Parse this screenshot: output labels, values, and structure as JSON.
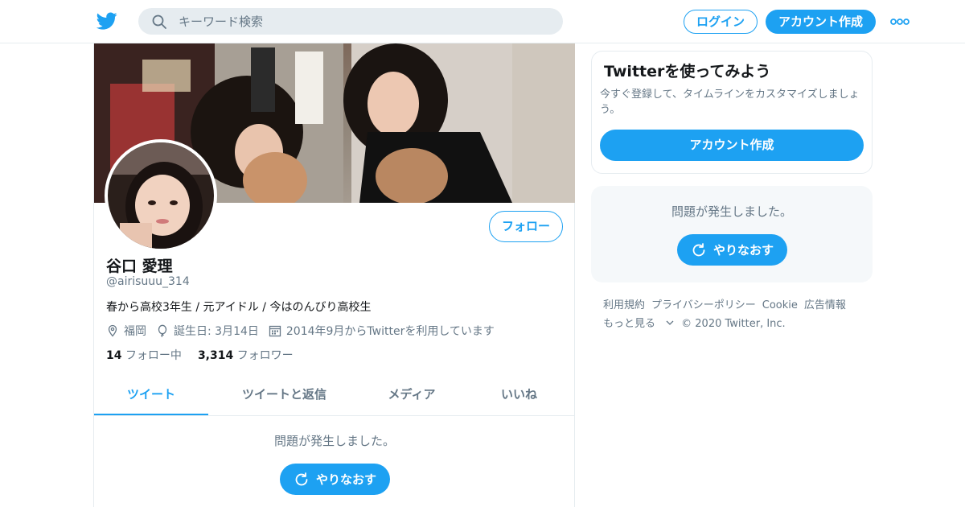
{
  "header": {
    "search_placeholder": "キーワード検索",
    "login_label": "ログイン",
    "signup_label": "アカウント作成"
  },
  "profile": {
    "name": "谷口 愛理",
    "handle": "@airisuuu_314",
    "bio": "春から高校3年生 / 元アイドル / 今はのんびり高校生",
    "location": "福岡",
    "birthday": "誕生日: 3月14日",
    "joined": "2014年9月からTwitterを利用しています",
    "following_count": "14",
    "following_label": "フォロー中",
    "followers_count": "3,314",
    "followers_label": "フォロワー",
    "follow_button": "フォロー"
  },
  "tabs": [
    {
      "label": "ツイート"
    },
    {
      "label": "ツイートと返信"
    },
    {
      "label": "メディア"
    },
    {
      "label": "いいね"
    }
  ],
  "timeline": {
    "error_text": "問題が発生しました。",
    "retry_label": "やりなおす"
  },
  "sidebar": {
    "try_title": "Twitterを使ってみよう",
    "try_desc": "今すぐ登録して、タイムラインをカスタマイズしましょう。",
    "signup_label": "アカウント作成",
    "error_text": "問題が発生しました。",
    "retry_label": "やりなおす"
  },
  "footer": {
    "links": [
      "利用規約",
      "プライバシーポリシー",
      "Cookie",
      "広告情報"
    ],
    "more_label": "もっと見る",
    "copyright": "© 2020 Twitter, Inc."
  },
  "colors": {
    "accent": "#1da1f2",
    "muted": "#657786",
    "border": "#e6ecf0"
  }
}
